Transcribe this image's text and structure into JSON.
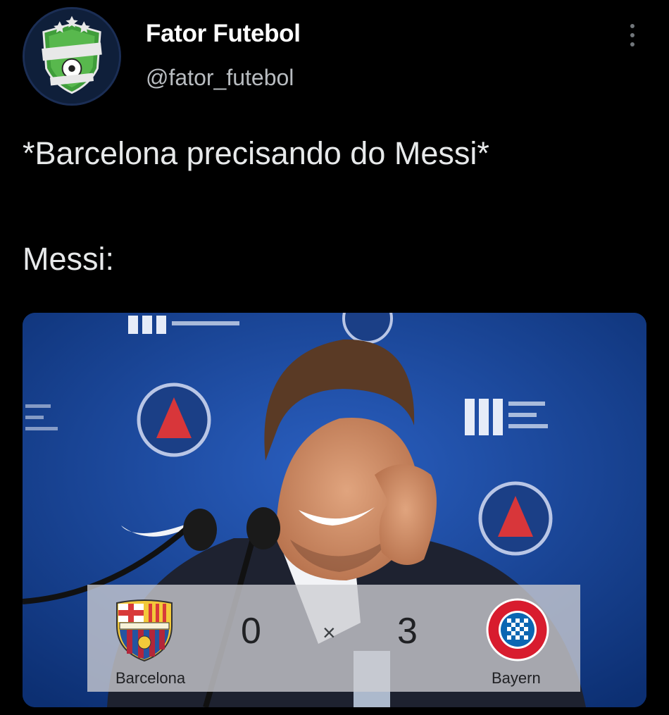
{
  "author": {
    "display_name": "Fator Futebol",
    "handle": "@fator_futebol",
    "avatar_icon": "fator-futebol-logo"
  },
  "tweet": {
    "line1": "*Barcelona precisando do Messi*",
    "line2": "Messi:"
  },
  "media": {
    "scoreboard": {
      "home_team": "Barcelona",
      "away_team": "Bayern",
      "home_score": "0",
      "away_score": "3",
      "separator": "×",
      "home_crest_icon": "fc-barcelona-crest",
      "away_crest_icon": "fc-bayern-crest"
    }
  },
  "colors": {
    "background": "#000000",
    "text": "#e7e9ea",
    "secondary_text": "#b8bcc0",
    "media_backdrop": "#123c88"
  }
}
